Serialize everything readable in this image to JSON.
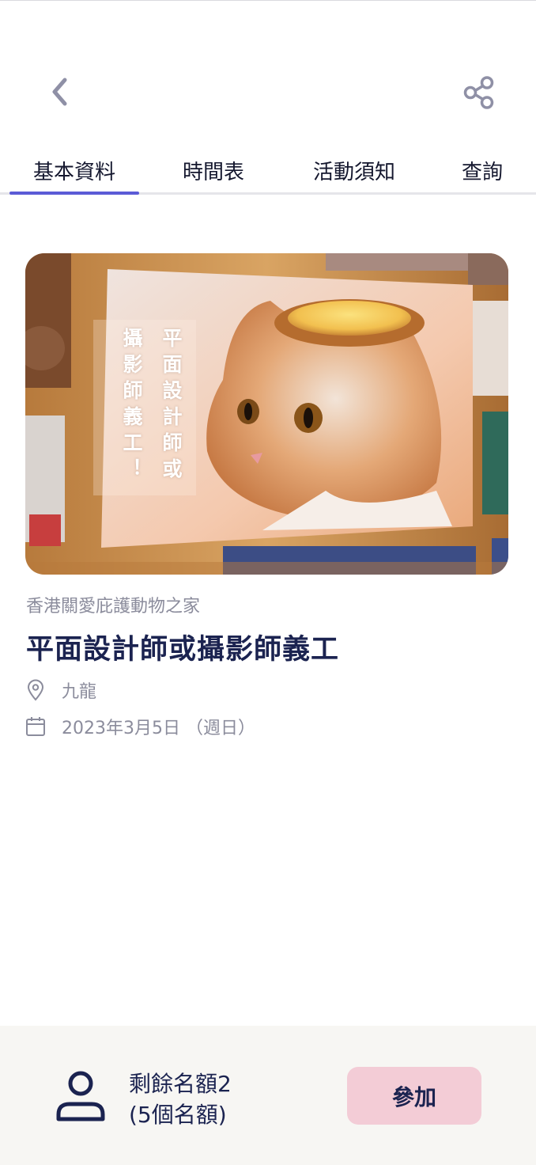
{
  "header": {
    "back_icon": "chevron-left-icon",
    "share_icon": "share-icon",
    "icon_color": "#8f90a6"
  },
  "tabs": [
    {
      "label": "基本資料",
      "active": true
    },
    {
      "label": "時間表",
      "active": false
    },
    {
      "label": "活動須知",
      "active": false
    },
    {
      "label": "查詢",
      "active": false
    }
  ],
  "accent_color": "#5b5bd6",
  "hero": {
    "caption_col1": "平面設計師或",
    "caption_col2": "攝影師義工！"
  },
  "event": {
    "organizer": "香港關愛庇護動物之家",
    "title": "平面設計師或攝影師義工",
    "location": "九龍",
    "location_icon": "map-pin-icon",
    "date": "2023年3月5日 （週日）",
    "date_icon": "calendar-icon"
  },
  "footer": {
    "person_icon": "user-icon",
    "quota_line1": "剩餘名額2",
    "quota_line2": "(5個名額)",
    "join_label": "參加",
    "join_color": "#f3ccd6",
    "background": "#f7f6f3"
  }
}
